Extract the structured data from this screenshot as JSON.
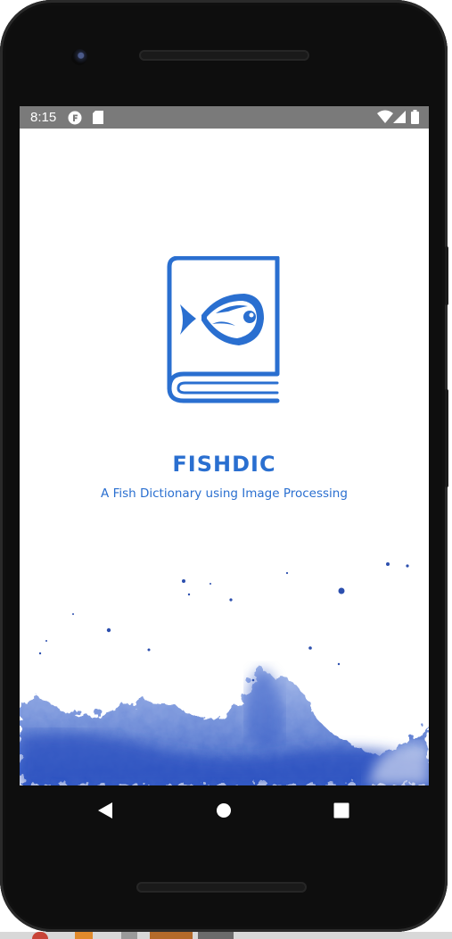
{
  "status_bar": {
    "time": "8:15",
    "icons": [
      "notification-f-icon",
      "sd-card-icon",
      "wifi-icon",
      "signal-icon",
      "battery-icon"
    ]
  },
  "app": {
    "title": "FISHDIC",
    "subtitle": "A Fish Dictionary using Image Processing",
    "logo_icon": "fish-book-icon"
  },
  "navigation": {
    "back_icon": "back-triangle-icon",
    "home_icon": "home-circle-icon",
    "recents_icon": "recents-square-icon"
  },
  "colors": {
    "brand_blue": "#2a6fd0",
    "status_bar": "#7a7a7a",
    "watercolor": "#3d63c4",
    "device_frame": "#0e0e0e"
  }
}
